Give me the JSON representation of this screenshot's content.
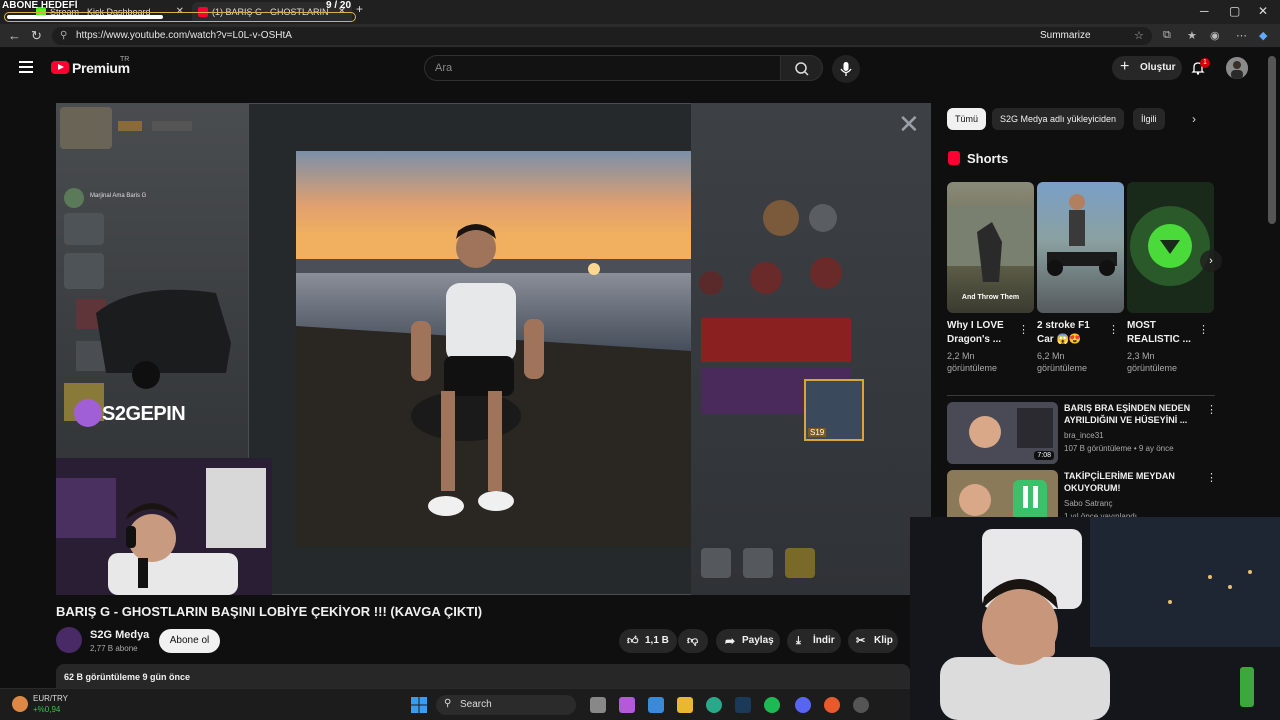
{
  "browser": {
    "overlay_title": "ABONE HEDEFİ",
    "overlay_count": "9 / 20",
    "overlay_progress": 0.45,
    "tabs": [
      {
        "label": "Stream - Kick Dashboard"
      },
      {
        "label": "(1) BARIŞ G - GHOSTLARIN"
      }
    ],
    "url": "https://www.youtube.com/watch?v=L0L-v-OSHtA",
    "summarize_label": "Summarize"
  },
  "youtube": {
    "logo_text": "Premium",
    "logo_region": "TR",
    "search_placeholder": "Ara",
    "create_label": "Oluştur",
    "notification_count": "1"
  },
  "player": {
    "overlay_brand": "S2GEPIN",
    "chat_name": "Marjinal Ama Baris G",
    "rank_label": "S19"
  },
  "video": {
    "title": "BARIŞ G - GHOSTLARIN BAŞINI LOBİYE ÇEKİYOR !!! (KAVGA ÇIKTI)",
    "channel_name": "S2G Medya",
    "channel_subs": "2,77 B abone",
    "subscribe_label": "Abone ol",
    "likes": "1,1 B",
    "share_label": "Paylaş",
    "download_label": "İndir",
    "clip_label": "Klip",
    "views_date": "62 B görüntüleme  9 gün önce"
  },
  "sidebar": {
    "chips": [
      "Tümü",
      "S2G Medya adlı yükleyiciden",
      "İlgili"
    ],
    "shorts_heading": "Shorts",
    "shorts": [
      {
        "caption": "And Throw Them",
        "title": "Why I LOVE\nDragon's ...",
        "views": "2,2 Mn\ngörüntüleme"
      },
      {
        "caption": "",
        "title": "2 stroke F1\nCar 😱😍",
        "views": "6,2 Mn\ngörüntüleme"
      },
      {
        "caption": "",
        "title": "MOST\nREALISTIC ...",
        "views": "2,3 Mn\ngörüntüleme"
      }
    ],
    "recommendations": [
      {
        "title": "BARIŞ BRA EŞİNDEN NEDEN AYRILDIĞINI VE HÜSEYİNİ ...",
        "channel": "bra_ince31",
        "meta": "107 B görüntüleme • 9 ay önce",
        "duration": "7:08"
      },
      {
        "title": "TAKİPÇİLERİME MEYDAN OKUYORUM!",
        "channel": "Sabo Satranç",
        "meta": "1 yıl önce yayınlandı",
        "duration": ""
      }
    ]
  },
  "taskbar": {
    "ticker_label": "EUR/TRY",
    "ticker_value": "+%0,94",
    "search_label": "Search"
  }
}
